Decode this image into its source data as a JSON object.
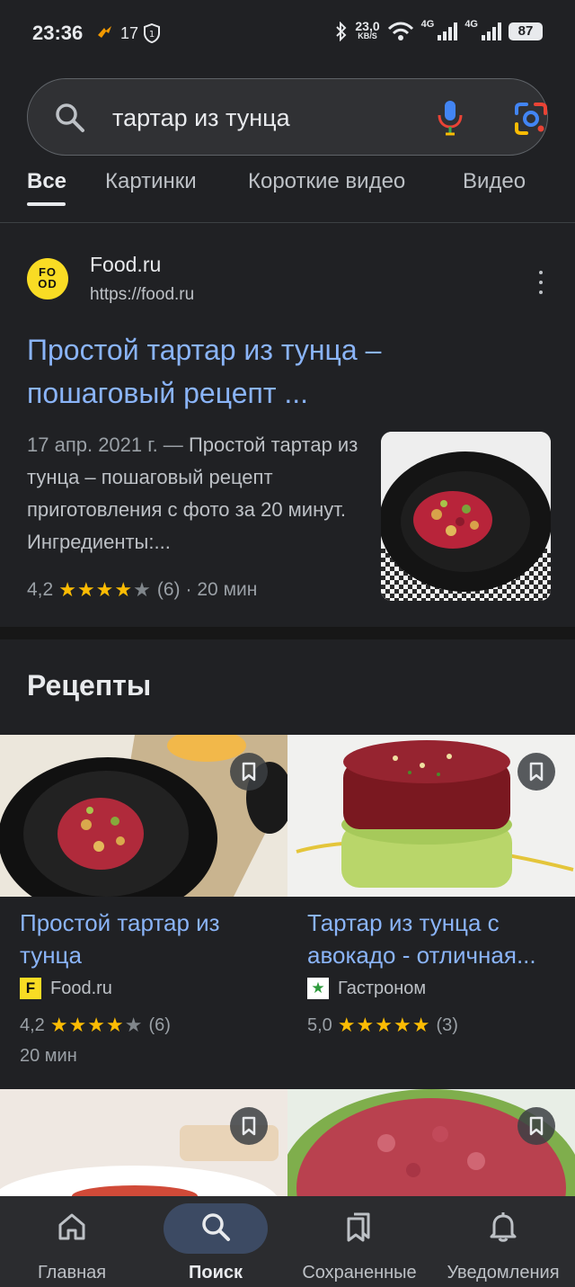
{
  "status_bar": {
    "time": "23:36",
    "notif_count": "17",
    "speed_value": "23,0",
    "speed_unit": "KB/S",
    "wifi_badge": "6",
    "net1": "4G",
    "net2": "4G",
    "battery": "87"
  },
  "search": {
    "query": "тартар из тунца",
    "icons": [
      "search-icon",
      "mic-icon",
      "lens-icon"
    ]
  },
  "tabs": [
    "Все",
    "Картинки",
    "Короткие видео",
    "Видео"
  ],
  "result": {
    "site_name": "Food.ru",
    "site_url": "https://food.ru",
    "favicon_text": "FO OD",
    "title": "Простой тартар из тунца – пошаговый рецепт ...",
    "date": "17 апр. 2021 г. —",
    "snippet": "Простой тартар из тунца – пошаговый рецепт приготовления с фото за 20 минут. Ингредиенты:...",
    "rating": "4,2",
    "stars": 4,
    "reviews": "(6)",
    "time": "· 20 мин"
  },
  "recipes": {
    "heading": "Рецепты",
    "cards": [
      {
        "title": "Простой тартар из тунца",
        "source": "Food.ru",
        "favicon_text": "F",
        "rating": "4,2",
        "stars": 4,
        "reviews": "(6)",
        "time": "20 мин"
      },
      {
        "title": "Тартар из тунца с авокадо - отличная...",
        "source": "Гастроном",
        "favicon_text": "★",
        "rating": "5,0",
        "stars": 5,
        "reviews": "(3)",
        "time": ""
      }
    ]
  },
  "nav": [
    {
      "label": "Главная",
      "icon": "home-icon"
    },
    {
      "label": "Поиск",
      "icon": "search-icon"
    },
    {
      "label": "Сохраненные",
      "icon": "bookmarks-icon"
    },
    {
      "label": "Уведомления",
      "icon": "bell-icon"
    }
  ],
  "colors": {
    "background": "#202124",
    "link": "#8ab4f8",
    "star": "#fbbc04",
    "nav_active_pill": "#3c4a63"
  }
}
